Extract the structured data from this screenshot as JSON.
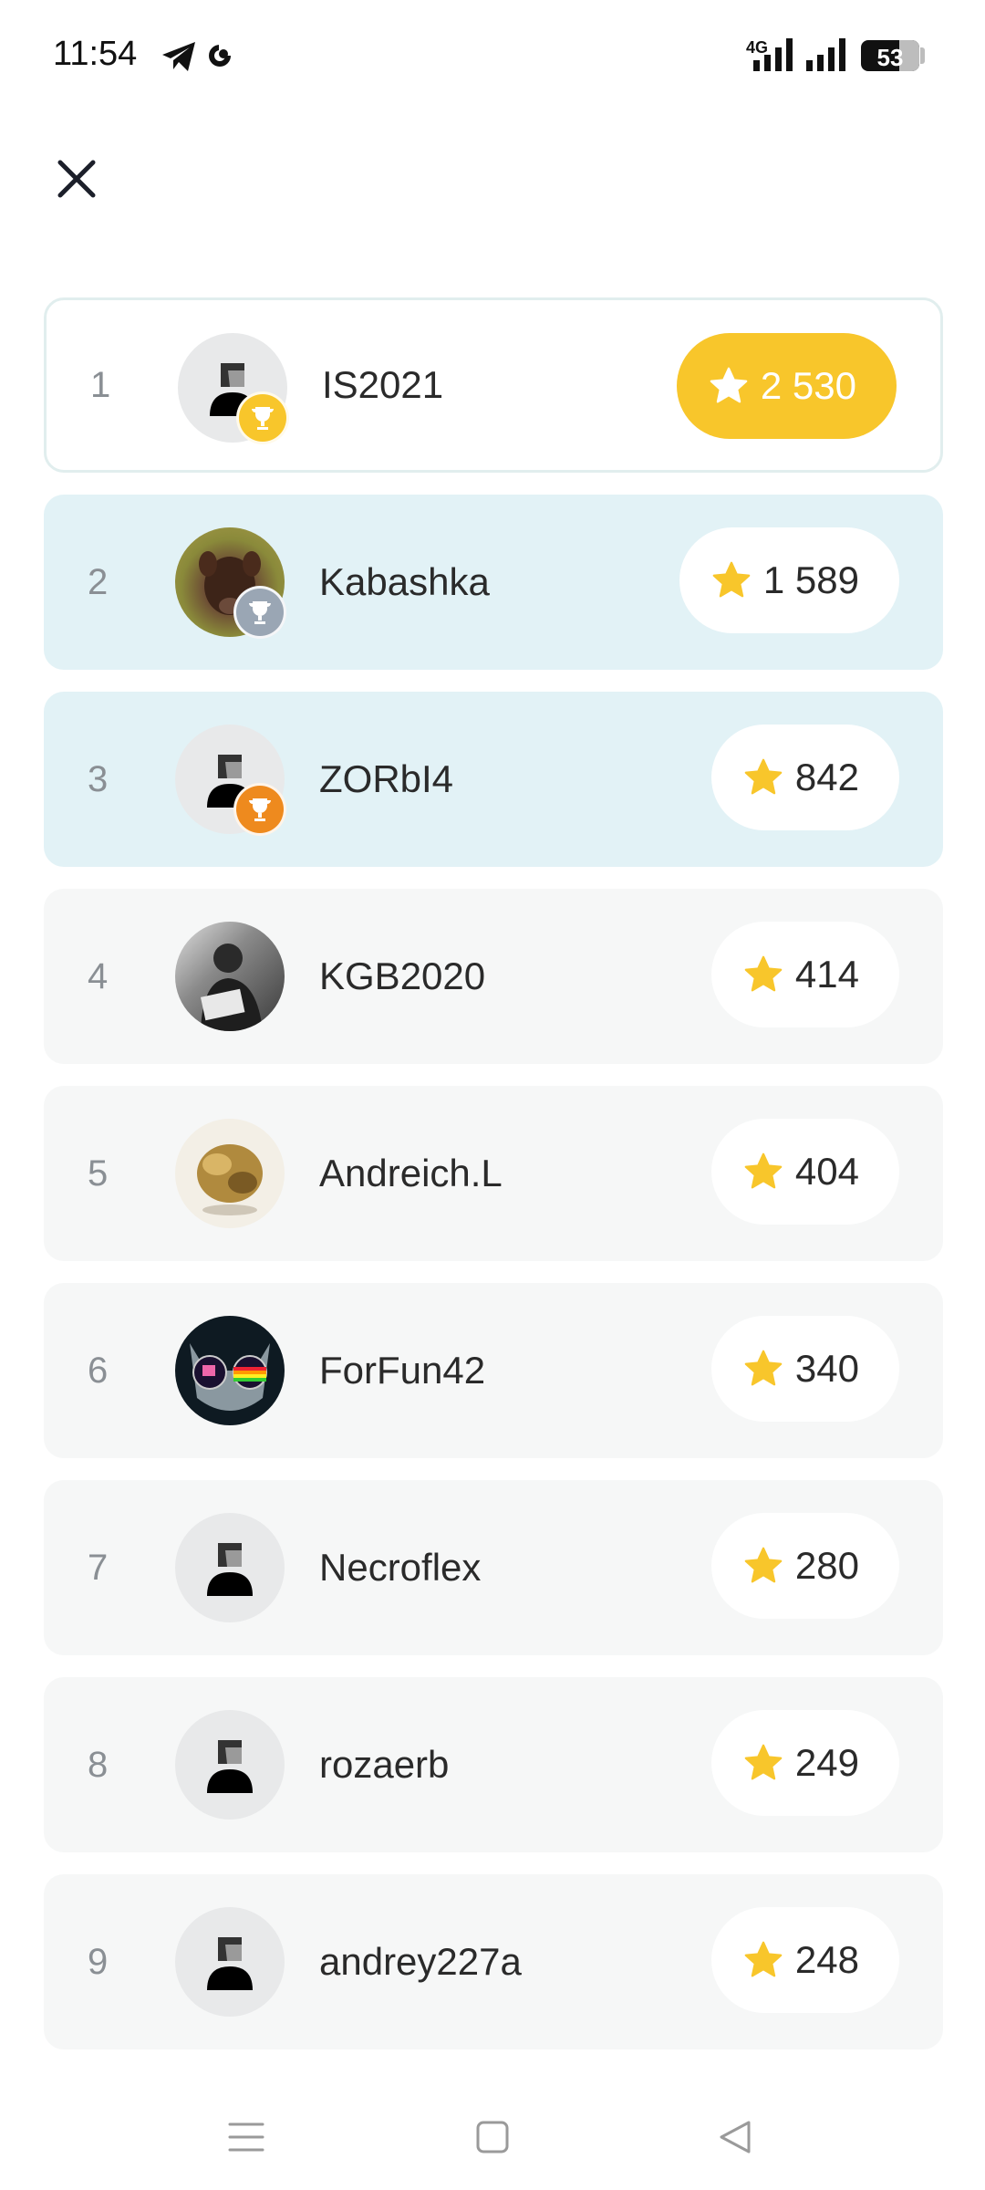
{
  "status_bar": {
    "time": "11:54",
    "network": "4G",
    "battery": "53",
    "icons": [
      "telegram-icon",
      "sync-icon",
      "signal-icon",
      "signal-icon",
      "battery-icon"
    ]
  },
  "header": {
    "close_icon": "close-icon"
  },
  "leaderboard": {
    "rows": [
      {
        "rank": "1",
        "name": "IS2021",
        "score": "2 530",
        "avatar": "default",
        "trophy": "gold"
      },
      {
        "rank": "2",
        "name": "Kabashka",
        "score": "1 589",
        "avatar": "boar-photo",
        "trophy": "silver"
      },
      {
        "rank": "3",
        "name": "ZORbI4",
        "score": "842",
        "avatar": "default",
        "trophy": "bronze"
      },
      {
        "rank": "4",
        "name": "KGB2020",
        "score": "414",
        "avatar": "bw-photo"
      },
      {
        "rank": "5",
        "name": "Andreich.L",
        "score": "404",
        "avatar": "bull-bear-statue-photo"
      },
      {
        "rank": "6",
        "name": "ForFun42",
        "score": "340",
        "avatar": "cat-glasses-photo"
      },
      {
        "rank": "7",
        "name": "Necroflex",
        "score": "280",
        "avatar": "default"
      },
      {
        "rank": "8",
        "name": "rozaerb",
        "score": "249",
        "avatar": "default"
      },
      {
        "rank": "9",
        "name": "andrey227a",
        "score": "248",
        "avatar": "default"
      }
    ]
  },
  "colors": {
    "gold": "#f8c62b",
    "silver": "#9aa6b4",
    "bronze": "#ee8a1e",
    "highlight": "#e2f2f6",
    "row_bg": "#f6f7f7",
    "star": "#f8c62b"
  },
  "navbar": {
    "icons": [
      "menu-icon",
      "home-icon",
      "back-icon"
    ]
  }
}
